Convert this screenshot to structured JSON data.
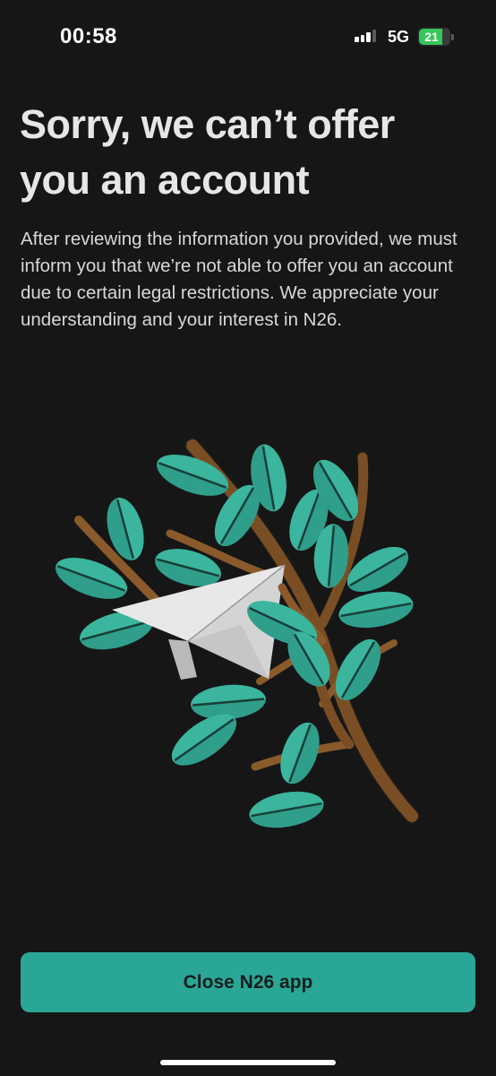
{
  "status_bar": {
    "time": "00:58",
    "network": "5G",
    "battery": "21",
    "signal_icon": "cellular-signal-icon",
    "battery_icon": "battery-charging-icon"
  },
  "content": {
    "title": "Sorry, we can’t offer you an account",
    "message": "After reviewing the information you provided, we must inform you that we’re not able to offer you an account due to certain legal restrictions. We appreciate your understanding and your interest in N26."
  },
  "illustration": {
    "icon": "paper-plane-in-branches-illustration",
    "leaf_color": "#2f9e8a",
    "branch_color": "#7a4e24",
    "plane_color": "#e8e8e8"
  },
  "actions": {
    "close_label": "Close N26 app"
  },
  "colors": {
    "background": "#161616",
    "accent": "#2aa696"
  }
}
